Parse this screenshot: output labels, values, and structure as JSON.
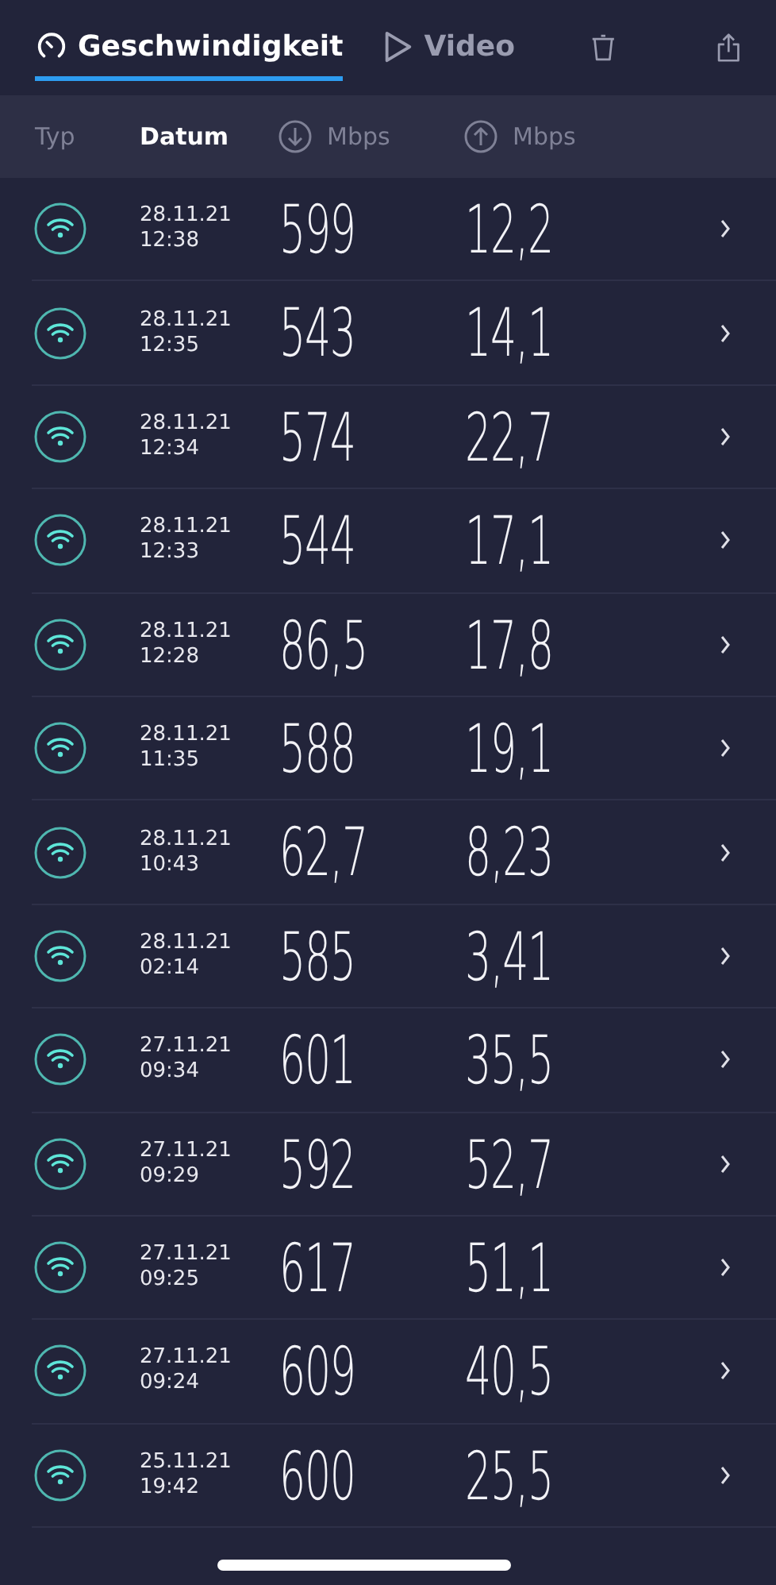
{
  "tabs": [
    {
      "label": "Geschwindigkeit",
      "kind": "speed",
      "selected": true
    },
    {
      "label": "Video",
      "kind": "video",
      "selected": false
    }
  ],
  "columns": [
    {
      "label": "Typ",
      "kind": "text",
      "selected": false
    },
    {
      "label": "Datum",
      "kind": "text",
      "selected": true
    },
    {
      "label": "Mbps",
      "kind": "download",
      "selected": false
    },
    {
      "label": "Mbps",
      "kind": "upload",
      "selected": false
    }
  ],
  "rows": [
    {
      "date": "28.11.21",
      "time": "12:38",
      "download": "599",
      "upload": "12,2"
    },
    {
      "date": "28.11.21",
      "time": "12:35",
      "download": "543",
      "upload": "14,1"
    },
    {
      "date": "28.11.21",
      "time": "12:34",
      "download": "574",
      "upload": "22,7"
    },
    {
      "date": "28.11.21",
      "time": "12:33",
      "download": "544",
      "upload": "17,1"
    },
    {
      "date": "28.11.21",
      "time": "12:28",
      "download": "86,5",
      "upload": "17,8"
    },
    {
      "date": "28.11.21",
      "time": "11:35",
      "download": "588",
      "upload": "19,1"
    },
    {
      "date": "28.11.21",
      "time": "10:43",
      "download": "62,7",
      "upload": "8,23"
    },
    {
      "date": "28.11.21",
      "time": "02:14",
      "download": "585",
      "upload": "3,41"
    },
    {
      "date": "27.11.21",
      "time": "09:34",
      "download": "601",
      "upload": "35,5"
    },
    {
      "date": "27.11.21",
      "time": "09:29",
      "download": "592",
      "upload": "52,7"
    },
    {
      "date": "27.11.21",
      "time": "09:25",
      "download": "617",
      "upload": "51,1"
    },
    {
      "date": "27.11.21",
      "time": "09:24",
      "download": "609",
      "upload": "40,5"
    },
    {
      "date": "25.11.21",
      "time": "19:42",
      "download": "600",
      "upload": "25,5"
    }
  ]
}
